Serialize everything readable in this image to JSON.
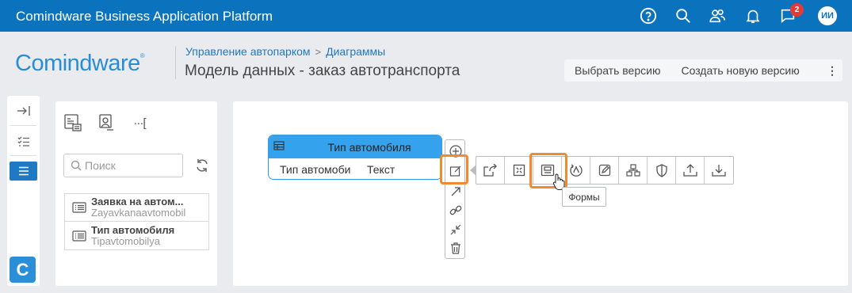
{
  "topbar": {
    "title": "Comindware Business Application Platform",
    "icons": [
      "help-icon",
      "search-icon",
      "users-icon",
      "bell-icon",
      "chat-icon"
    ],
    "notification_count": "2",
    "avatar_initials": "ИИ",
    "bg_color": "#0b73bd"
  },
  "header": {
    "logo_text": "Comindware",
    "logo_mark": "®",
    "breadcrumb": [
      "Управление автопарком",
      "Диаграммы"
    ],
    "breadcrumb_separator": ">",
    "title": "Модель данных - заказ автотранспорта",
    "buttons": {
      "select_version": "Выбрать версию",
      "create_version": "Создать новую версию",
      "more": "⋮"
    }
  },
  "left_strip": {
    "icons": [
      "collapse-icon",
      "checklist-icon",
      "list-icon"
    ],
    "active": "list-icon",
    "brand_letter": "C"
  },
  "panel": {
    "tab_icons": [
      "form-list-icon",
      "user-form-icon",
      "more-brackets-icon"
    ],
    "more_label": "···[",
    "search_placeholder": "Поиск",
    "items": [
      {
        "title": "Заявка на автом...",
        "subtitle": "Zayavkanaavtomobil"
      },
      {
        "title": "Тип автомобиля",
        "subtitle": "Tipavtomobilya"
      }
    ]
  },
  "canvas": {
    "entity": {
      "name": "Тип автомобиля",
      "attribute_name": "Тип автомоби",
      "attribute_type": "Текст"
    },
    "vertical_tools": [
      "add-icon",
      "edit-icon",
      "arrow-icon",
      "link-icon",
      "collapse-arrows-icon",
      "delete-icon"
    ],
    "horizontal_tools": [
      "open-external-icon",
      "expand-icon",
      "forms-icon",
      "process-icon",
      "edit-form-icon",
      "hierarchy-icon",
      "shield-icon",
      "upload-icon",
      "download-icon"
    ],
    "tooltip": "Формы",
    "highlight_color": "#ef8a2e",
    "entity_color": "#35a2ee"
  }
}
